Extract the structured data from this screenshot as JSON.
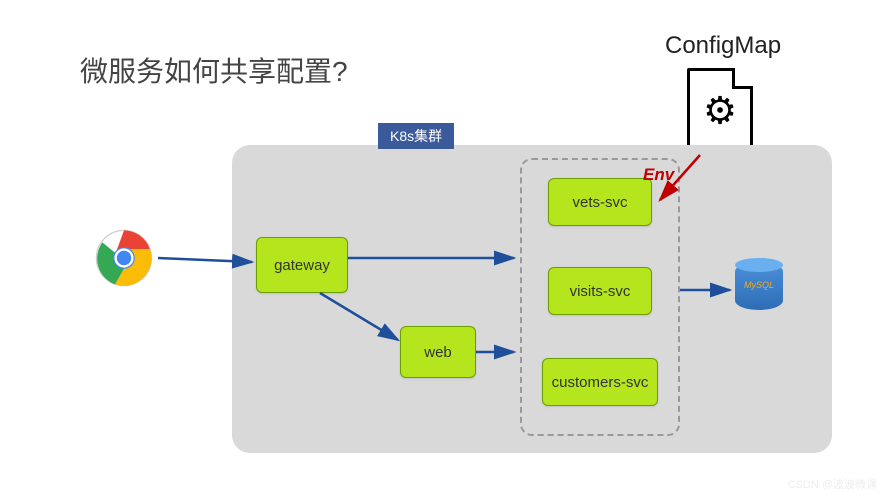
{
  "title": "微服务如何共享配置?",
  "configmap": {
    "label": "ConfigMap"
  },
  "cluster": {
    "label": "K8s集群"
  },
  "nodes": {
    "gateway": "gateway",
    "web": "web",
    "vets": "vets-svc",
    "visits": "visits-svc",
    "customers": "customers-svc"
  },
  "env_label": "Env",
  "db_label": "MySQL",
  "watermark": "CSDN @波波微课",
  "arrows": [
    {
      "from": "chrome",
      "to": "gateway"
    },
    {
      "from": "gateway",
      "to": "svc-group-top"
    },
    {
      "from": "gateway",
      "to": "web"
    },
    {
      "from": "web",
      "to": "svc-group-mid"
    },
    {
      "from": "visits",
      "to": "db"
    },
    {
      "from": "configmap",
      "to": "svc-group",
      "style": "red",
      "label": "Env"
    }
  ]
}
